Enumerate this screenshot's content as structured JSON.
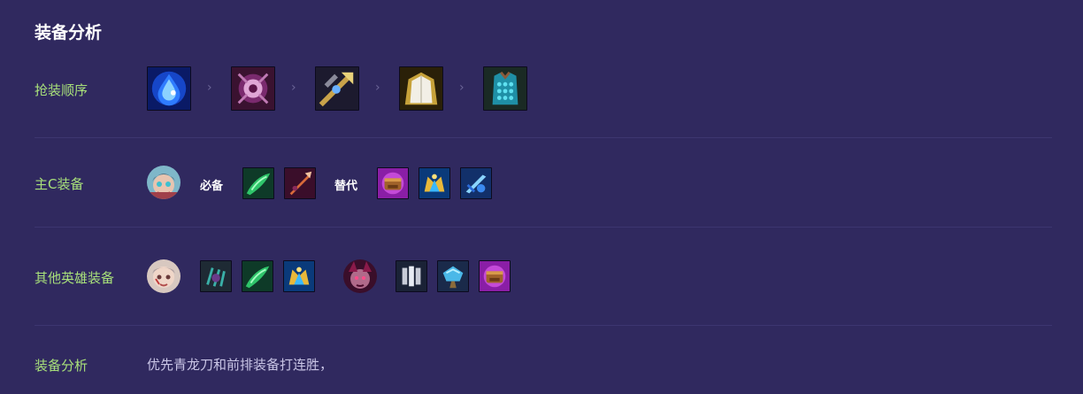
{
  "title": "装备分析",
  "rows": {
    "order": {
      "label": "抢装顺序",
      "separator": "›"
    },
    "carry": {
      "label": "主C装备",
      "required_label": "必备",
      "alternative_label": "替代"
    },
    "others": {
      "label": "其他英雄装备"
    },
    "analysis": {
      "label": "装备分析",
      "text": "优先青龙刀和前排装备打连胜，"
    }
  },
  "colors": {
    "background": "#30295f",
    "label_green": "#a8e07a",
    "divider": "#3d3670"
  },
  "icons": {
    "order": [
      "blue-tear-icon",
      "purple-sigil-icon",
      "golden-spear-icon",
      "white-cloak-icon",
      "chainmail-vest-icon"
    ],
    "carry_required": [
      "green-blade-icon",
      "pink-dagger-icon"
    ],
    "carry_alternative": [
      "golden-gauntlet-icon",
      "blue-crown-icon",
      "ice-sword-icon"
    ],
    "others_first": [
      "dark-claw-icon",
      "green-blade-icon",
      "blue-crown-icon"
    ],
    "others_second": [
      "silver-shield-icon",
      "crystal-hammer-icon",
      "golden-gauntlet-icon"
    ]
  }
}
